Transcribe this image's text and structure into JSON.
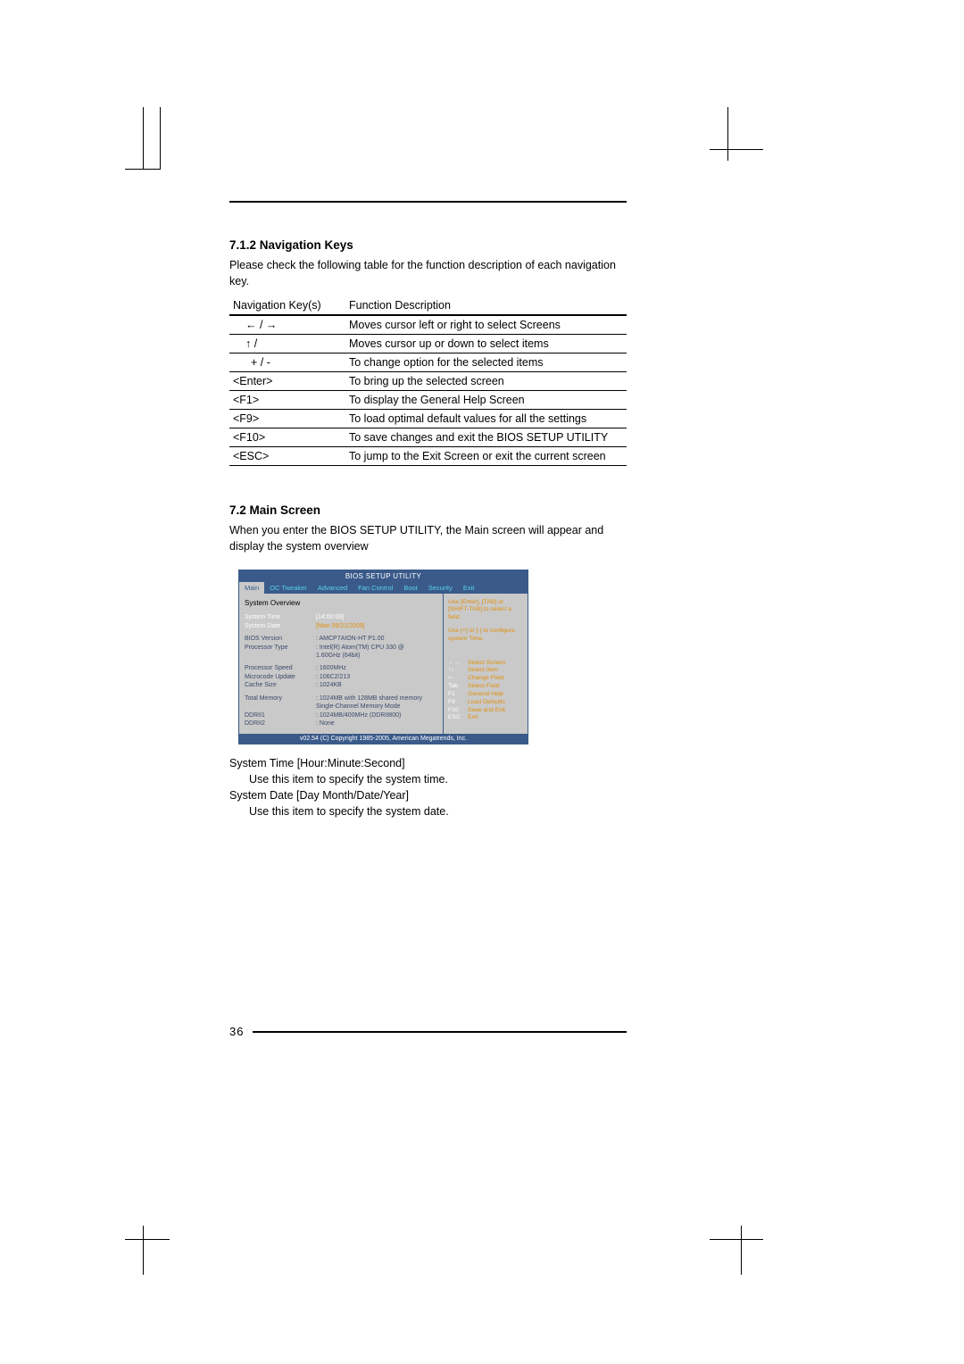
{
  "section1": {
    "heading": "7.1.2 Navigation Keys",
    "intro": "Please check the following table for the function description of each navigation key.",
    "table_header_key": "Navigation Key(s)",
    "table_header_desc": "Function Description",
    "rows": [
      {
        "key": "← / →",
        "desc": "Moves cursor left or right to select Screens"
      },
      {
        "key": "↑ /",
        "desc": "Moves cursor up or down to select items"
      },
      {
        "key": "+  /  -",
        "desc": "To change option for the selected items"
      },
      {
        "key": "<Enter>",
        "desc": "To bring up the selected screen"
      },
      {
        "key": "<F1>",
        "desc": "To display the General Help Screen"
      },
      {
        "key": "<F9>",
        "desc": "To load optimal default values for all the settings"
      },
      {
        "key": "<F10>",
        "desc": "To save changes and exit the BIOS SETUP UTILITY"
      },
      {
        "key": "<ESC>",
        "desc": "To jump to the Exit Screen or exit the current screen"
      }
    ]
  },
  "section2": {
    "heading": "7.2  Main Screen",
    "intro": "When you enter the BIOS SETUP UTILITY, the Main screen will appear and display the system overview"
  },
  "bios": {
    "title": "BIOS SETUP UTILITY",
    "tabs": [
      "Main",
      "OC Tweaker",
      "Advanced",
      "Fan Control",
      "Boot",
      "Security",
      "Exit"
    ],
    "overview_title": "System Overview",
    "rows": [
      {
        "lbl": "System Time",
        "val": "[14:00:09]",
        "hl": true
      },
      {
        "lbl": "System Date",
        "val": "[Mon 09/21/2009]",
        "hlv": true
      },
      {
        "lbl": "BIOS Version",
        "val": ": AMCP7AION-HT P1.00"
      },
      {
        "lbl": "Processor Type",
        "val": ": Intel(R) Atom(TM) CPU 330 @"
      },
      {
        "lbl": "",
        "val": "  1.60GHz (64bit)"
      },
      {
        "lbl": "Processor Speed",
        "val": ": 1600MHz"
      },
      {
        "lbl": "Microcode Update",
        "val": ": 106C2/213"
      },
      {
        "lbl": "Cache Size",
        "val": ": 1024KB"
      },
      {
        "lbl": "Total Memory",
        "val": ": 1024MB with 128MB shared memory"
      },
      {
        "lbl": "",
        "val": "  Single-Channel Memory Mode"
      },
      {
        "lbl": "DDRII1",
        "val": ": 1024MB/400MHz (DDRII800)"
      },
      {
        "lbl": "DDRII2",
        "val": ": None"
      }
    ],
    "help_top": "Use [Enter], [TAB] or [SHIFT-TAB] to select a field.",
    "help_mid": "Use [+] or [-] to configure system Time.",
    "key_hints": [
      {
        "k": "←→",
        "d": "Select Screen"
      },
      {
        "k": "↑↓",
        "d": "Select Item"
      },
      {
        "k": "+-",
        "d": "Change Field"
      },
      {
        "k": "Tab",
        "d": "Select Field"
      },
      {
        "k": "F1",
        "d": "General Help"
      },
      {
        "k": "F9",
        "d": "Load Defaults"
      },
      {
        "k": "F10",
        "d": "Save and Exit"
      },
      {
        "k": "ESC",
        "d": "Exit"
      }
    ],
    "footer": "v02.54 (C) Copyright 1985-2005, American Megatrends, Inc."
  },
  "sys_desc": {
    "t1": "System Time [Hour:Minute:Second]",
    "d1": "Use this item to specify the system time.",
    "t2": "System Date [Day Month/Date/Year]",
    "d2": "Use this item to specify the system date."
  },
  "page_number": "36"
}
